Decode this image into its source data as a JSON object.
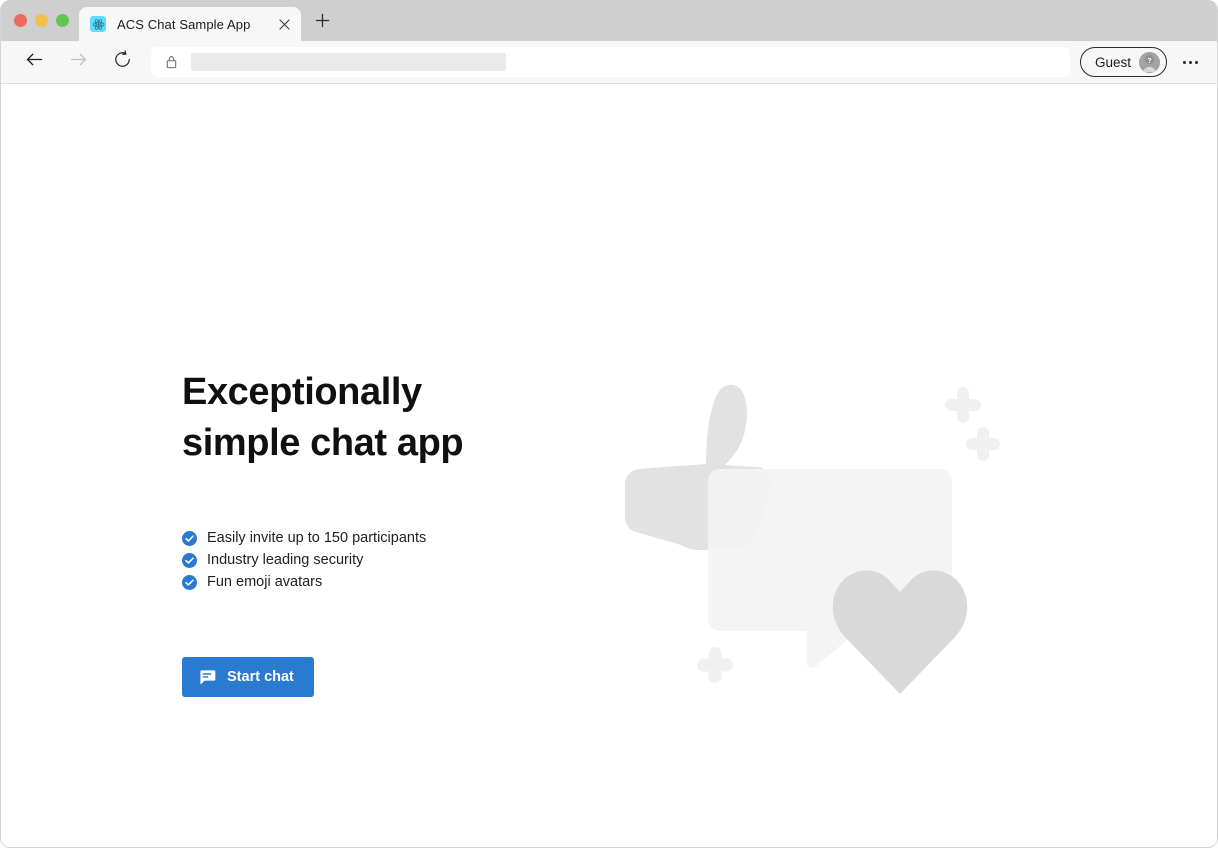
{
  "browser": {
    "window_controls": [
      {
        "name": "close",
        "color": "#ec6a5e"
      },
      {
        "name": "minimize",
        "color": "#f4bf4f"
      },
      {
        "name": "maximize",
        "color": "#61c454"
      }
    ],
    "tab": {
      "title": "ACS Chat Sample App",
      "favicon": "react-logo-icon",
      "close_icon": "close-icon"
    },
    "new_tab_icon": "plus-icon",
    "toolbar": {
      "back_icon": "arrow-left-icon",
      "forward_icon": "arrow-right-icon",
      "reload_icon": "reload-icon",
      "lock_icon": "lock-icon",
      "url_value": "",
      "url_placeholder": "",
      "profile_label": "Guest",
      "profile_avatar_icon": "person-question-avatar-icon",
      "menu_icon": "more-horizontal-icon"
    }
  },
  "page": {
    "title": "Exceptionally simple chat app",
    "features": [
      {
        "icon": "check-circle-icon",
        "label": "Easily invite up to 150 participants"
      },
      {
        "icon": "check-circle-icon",
        "label": "Industry leading security"
      },
      {
        "icon": "check-circle-icon",
        "label": "Fun emoji avatars"
      }
    ],
    "cta": {
      "label": "Start chat",
      "icon": "chat-bubble-icon"
    },
    "illustration": {
      "name": "chat-hero-illustration",
      "shapes": [
        "thumbs-up",
        "speech-bubble",
        "heart",
        "sparkle-plus",
        "sparkle-plus",
        "sparkle-plus"
      ]
    }
  },
  "colors": {
    "accent": "#2a7ad2",
    "check": "#2a7ad2",
    "title_text": "#101010",
    "body_text": "#1f1f1f",
    "titlebar_bg": "#cfcfcf",
    "toolbar_bg": "#f7f7f7",
    "page_bg": "#ffffff",
    "illustration_light": "#f3f3f3",
    "illustration_mid": "#e2e2e2",
    "illustration_dark": "#d6d6d6"
  }
}
